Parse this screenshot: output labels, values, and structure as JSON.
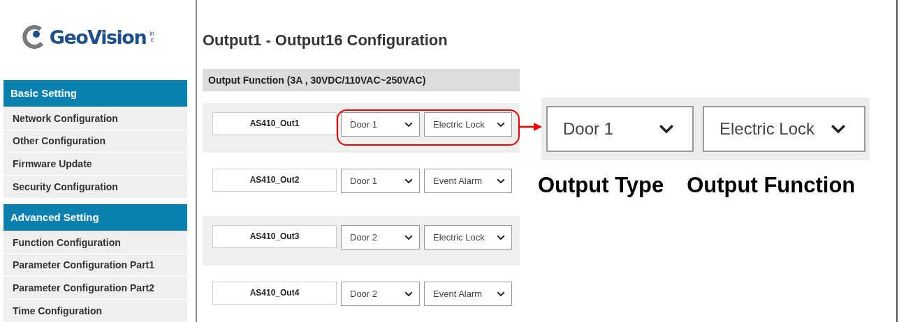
{
  "logo": {
    "name": "GeoVision",
    "suffix": "inc"
  },
  "sidebar": {
    "groups": [
      {
        "title": "Basic Setting",
        "items": [
          {
            "label": "Network Configuration"
          },
          {
            "label": "Other Configuration"
          },
          {
            "label": "Firmware Update"
          },
          {
            "label": "Security Configuration"
          }
        ]
      },
      {
        "title": "Advanced Setting",
        "items": [
          {
            "label": "Function Configuration"
          },
          {
            "label": "Parameter Configuration Part1"
          },
          {
            "label": "Parameter Configuration Part2"
          },
          {
            "label": "Time Configuration"
          }
        ]
      }
    ]
  },
  "page_title": "Output1 - Output16 Configuration",
  "section_header": "Output Function (3A , 30VDC/110VAC~250VAC)",
  "outputs": [
    {
      "name": "AS410_Out1",
      "type": "Door 1",
      "function": "Electric Lock",
      "highlighted": true
    },
    {
      "name": "AS410_Out2",
      "type": "Door 1",
      "function": "Event Alarm",
      "highlighted": false
    },
    {
      "name": "AS410_Out3",
      "type": "Door 2",
      "function": "Electric Lock",
      "highlighted": false
    },
    {
      "name": "AS410_Out4",
      "type": "Door 2",
      "function": "Event Alarm",
      "highlighted": false
    }
  ],
  "callout": {
    "type": "Door 1",
    "function": "Electric Lock",
    "labels": [
      "Output Type",
      "Output Function"
    ]
  }
}
